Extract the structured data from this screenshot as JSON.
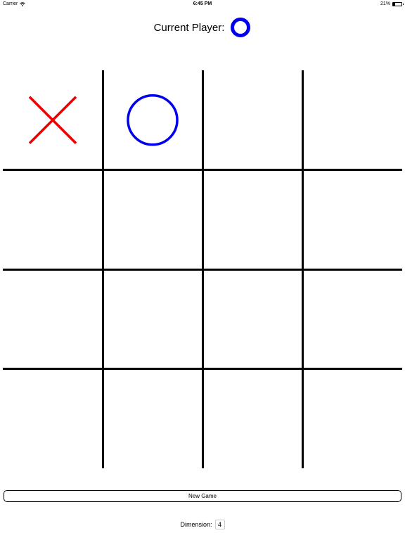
{
  "status_bar": {
    "carrier": "Carrier",
    "time": "6:45 PM",
    "battery": "21%",
    "battery_level": 0.21
  },
  "header": {
    "label": "Current Player:",
    "current_player": "O",
    "o_color": "#0000ee",
    "x_color": "#ee0000"
  },
  "board": {
    "dimension": 4,
    "cells": [
      [
        "X",
        "O",
        "",
        ""
      ],
      [
        "",
        "",
        "",
        ""
      ],
      [
        "",
        "",
        "",
        ""
      ],
      [
        "",
        "",
        "",
        ""
      ]
    ]
  },
  "controls": {
    "new_game_label": "New Game",
    "dimension_label": "Dimension:",
    "dimension_value": "4"
  }
}
